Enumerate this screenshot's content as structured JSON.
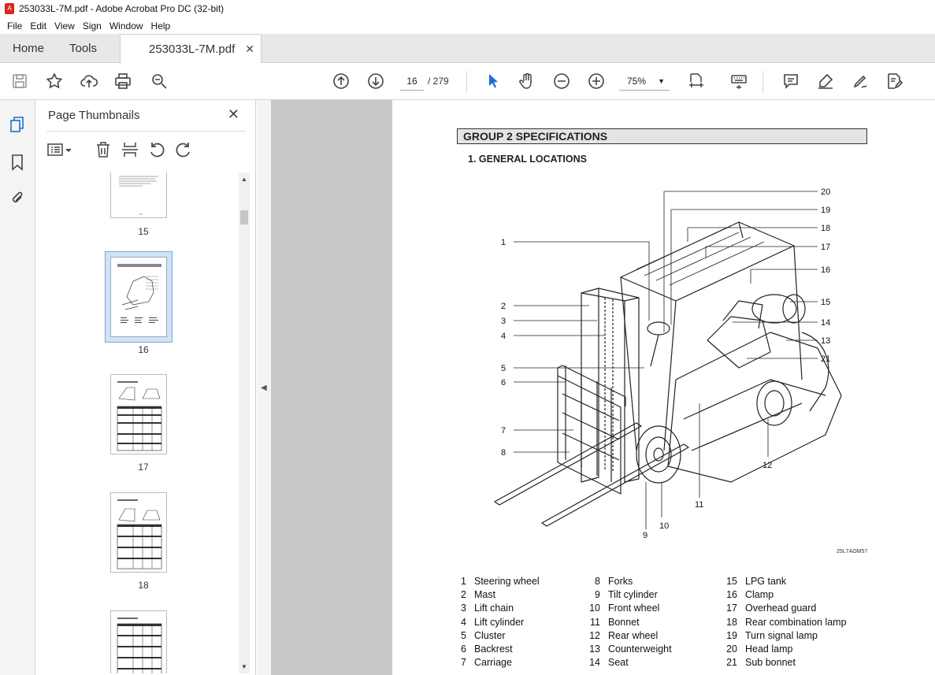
{
  "window": {
    "title": "253033L-7M.pdf - Adobe Acrobat Pro DC (32-bit)"
  },
  "menu": [
    "File",
    "Edit",
    "View",
    "Sign",
    "Window",
    "Help"
  ],
  "tabs": {
    "home": "Home",
    "tools": "Tools",
    "document": "253033L-7M.pdf"
  },
  "toolbar": {
    "page_current": "16",
    "page_total": "/ 279",
    "zoom": "75%"
  },
  "sidebar": {
    "title": "Page Thumbnails",
    "thumbnails": [
      {
        "label": "15"
      },
      {
        "label": "16"
      },
      {
        "label": "17"
      },
      {
        "label": "18"
      }
    ]
  },
  "page": {
    "group_header": "GROUP 2 SPECIFICATIONS",
    "section_header": "1. GENERAL LOCATIONS",
    "figure_code": "25L7AOM57",
    "callouts": [
      "1",
      "2",
      "3",
      "4",
      "5",
      "6",
      "7",
      "8",
      "9",
      "10",
      "11",
      "12",
      "13",
      "14",
      "15",
      "16",
      "17",
      "18",
      "19",
      "20",
      "21"
    ],
    "legend": [
      {
        "n": "1",
        "label": "Steering wheel"
      },
      {
        "n": "2",
        "label": "Mast"
      },
      {
        "n": "3",
        "label": "Lift chain"
      },
      {
        "n": "4",
        "label": "Lift cylinder"
      },
      {
        "n": "5",
        "label": "Cluster"
      },
      {
        "n": "6",
        "label": "Backrest"
      },
      {
        "n": "7",
        "label": "Carriage"
      },
      {
        "n": "8",
        "label": "Forks"
      },
      {
        "n": "9",
        "label": "Tilt cylinder"
      },
      {
        "n": "10",
        "label": "Front wheel"
      },
      {
        "n": "11",
        "label": "Bonnet"
      },
      {
        "n": "12",
        "label": "Rear wheel"
      },
      {
        "n": "13",
        "label": "Counterweight"
      },
      {
        "n": "14",
        "label": "Seat"
      },
      {
        "n": "15",
        "label": "LPG tank"
      },
      {
        "n": "16",
        "label": "Clamp"
      },
      {
        "n": "17",
        "label": "Overhead guard"
      },
      {
        "n": "18",
        "label": "Rear combination lamp"
      },
      {
        "n": "19",
        "label": "Turn signal lamp"
      },
      {
        "n": "20",
        "label": "Head lamp"
      },
      {
        "n": "21",
        "label": "Sub bonnet"
      }
    ]
  }
}
